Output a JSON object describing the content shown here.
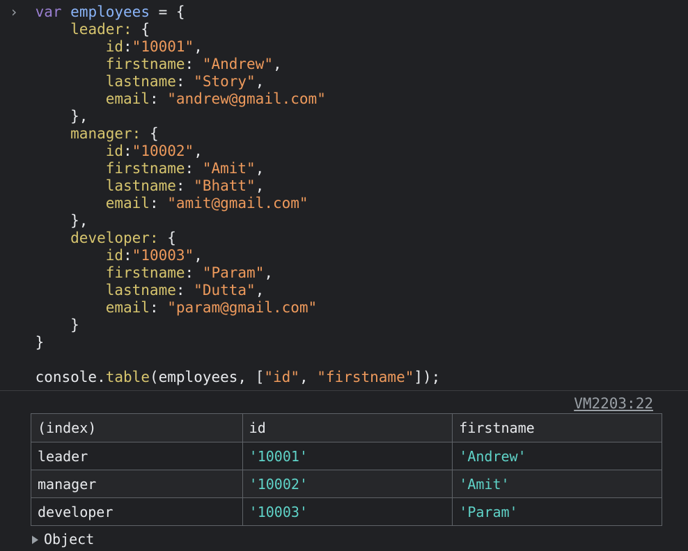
{
  "code": {
    "prompt": "›",
    "keyword": "var",
    "var_name": "employees",
    "entries": [
      {
        "key": "leader",
        "id": "10001",
        "firstname": "Andrew",
        "lastname": "Story",
        "email": "andrew@gmail.com"
      },
      {
        "key": "manager",
        "id": "10002",
        "firstname": "Amit",
        "lastname": "Bhatt",
        "email": "amit@gmail.com"
      },
      {
        "key": "developer",
        "id": "10003",
        "firstname": "Param",
        "lastname": "Dutta",
        "email": "param@gmail.com"
      }
    ],
    "field_labels": {
      "id": "id",
      "firstname": "firstname",
      "lastname": "lastname",
      "email": "email"
    },
    "call": {
      "object": "console",
      "method": "table",
      "arg": "employees",
      "columns_arg": [
        "id",
        "firstname"
      ]
    }
  },
  "output": {
    "source_link": "VM2203:22",
    "table": {
      "headers": [
        "(index)",
        "id",
        "firstname"
      ],
      "rows": [
        [
          "leader",
          "'10001'",
          "'Andrew'"
        ],
        [
          "manager",
          "'10002'",
          "'Amit'"
        ],
        [
          "developer",
          "'10003'",
          "'Param'"
        ]
      ]
    },
    "object_label": "Object"
  },
  "colors": {
    "background": "#202124",
    "keyword": "#9a7fd1",
    "variable": "#8ab4f8",
    "property": "#d7c56e",
    "string": "#ee9a5c",
    "table_value": "#5fd3c8"
  }
}
